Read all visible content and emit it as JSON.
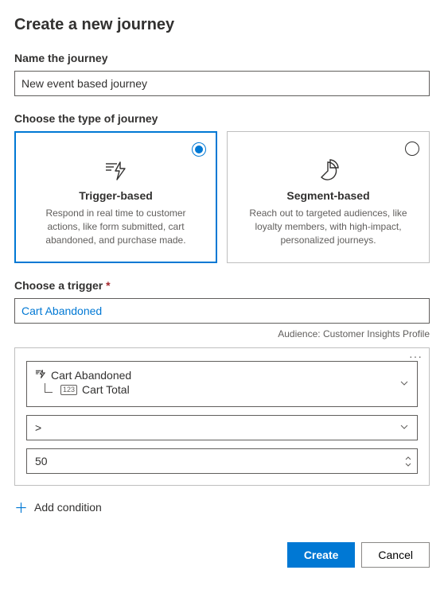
{
  "header": {
    "title": "Create a new journey"
  },
  "name_field": {
    "label": "Name the journey",
    "value": "New event based journey"
  },
  "type_field": {
    "label": "Choose the type of journey",
    "cards": [
      {
        "title": "Trigger-based",
        "desc": "Respond in real time to customer actions, like form submitted, cart abandoned, and purchase made.",
        "selected": true
      },
      {
        "title": "Segment-based",
        "desc": "Reach out to targeted audiences, like loyalty members, with high-impact, personalized journeys.",
        "selected": false
      }
    ]
  },
  "trigger_field": {
    "label": "Choose a trigger",
    "required": "*",
    "value": "Cart Abandoned",
    "audience_label": "Audience:",
    "audience_value": "Customer Insights Profile"
  },
  "condition": {
    "event": "Cart Abandoned",
    "attribute": "Cart Total",
    "operator": ">",
    "value": "50"
  },
  "add_condition_label": "Add condition",
  "footer": {
    "create": "Create",
    "cancel": "Cancel"
  }
}
